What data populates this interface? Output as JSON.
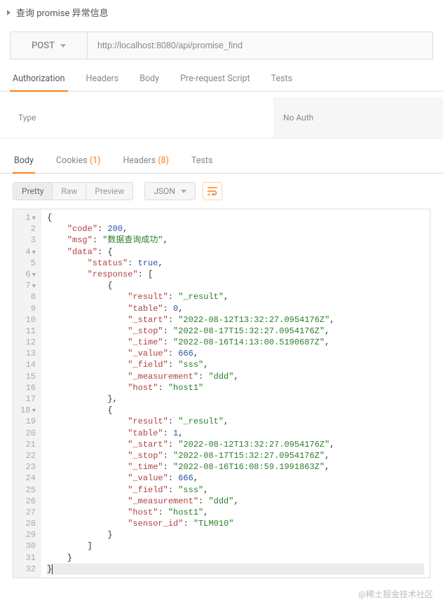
{
  "header": {
    "title": "查询 promise 异常信息"
  },
  "request": {
    "method": "POST",
    "url": "http://localhost:8080/api/promise_find"
  },
  "tabs": {
    "authorization": "Authorization",
    "headers": "Headers",
    "body": "Body",
    "prerequest": "Pre-request Script",
    "tests": "Tests"
  },
  "auth": {
    "type_label": "Type",
    "value": "No Auth"
  },
  "rtabs": {
    "body": "Body",
    "cookies": "Cookies",
    "cookies_count": "(1)",
    "headers": "Headers",
    "headers_count": "(8)",
    "tests": "Tests"
  },
  "toolbar": {
    "pretty": "Pretty",
    "raw": "Raw",
    "preview": "Preview",
    "format": "JSON"
  },
  "lines": [
    1,
    2,
    3,
    4,
    5,
    6,
    7,
    8,
    9,
    10,
    11,
    12,
    13,
    14,
    15,
    16,
    17,
    18,
    19,
    20,
    21,
    22,
    23,
    24,
    25,
    26,
    27,
    28,
    29,
    30,
    31,
    32
  ],
  "fold_lines": [
    1,
    4,
    6,
    7,
    18
  ],
  "response_body": {
    "code": 200,
    "msg": "数据查询成功",
    "data": {
      "status": true,
      "response": [
        {
          "result": "_result",
          "table": 0,
          "_start": "2022-08-12T13:32:27.0954176Z",
          "_stop": "2022-08-17T15:32:27.0954176Z",
          "_time": "2022-08-16T14:13:00.5190687Z",
          "_value": 666,
          "_field": "sss",
          "_measurement": "ddd",
          "host": "host1"
        },
        {
          "result": "_result",
          "table": 1,
          "_start": "2022-08-12T13:32:27.0954176Z",
          "_stop": "2022-08-17T15:32:27.0954176Z",
          "_time": "2022-08-16T16:08:59.1991863Z",
          "_value": 666,
          "_field": "sss",
          "_measurement": "ddd",
          "host": "host1",
          "sensor_id": "TLM010"
        }
      ]
    }
  },
  "watermark": "@稀土掘金技术社区"
}
